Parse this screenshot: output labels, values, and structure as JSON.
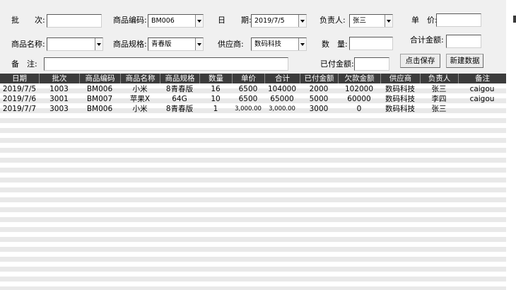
{
  "form": {
    "batch_label": "批　　次:",
    "batch_value": "",
    "code_label": "商品编码:",
    "code_value": "BM006",
    "date_label": "日　　期:",
    "date_value": "2019/7/5",
    "owner_label": "负责人:",
    "owner_value": "张三",
    "price_label": "单　价:",
    "price_value": "",
    "name_label": "商品名称:",
    "name_value": "",
    "spec_label": "商品规格:",
    "spec_value": "青春版",
    "supplier_label": "供应商:",
    "supplier_value": "数码科技",
    "qty_label": "数　量:",
    "qty_value": "",
    "total_label": "合计金额:",
    "total_value": "",
    "note_label": "备　注:",
    "note_value": "",
    "paid_label": "已付金额:",
    "paid_value": "",
    "save_button": "点击保存",
    "new_button": "新建数据"
  },
  "table": {
    "columns": [
      "日期",
      "批次",
      "商品编码",
      "商品名称",
      "商品规格",
      "数量",
      "单价",
      "合计",
      "已付金额",
      "欠款金额",
      "供应商",
      "负责人",
      "备注"
    ],
    "rows": [
      [
        "2019/7/5",
        "1003",
        "BM006",
        "小米",
        "8青春版",
        "16",
        "6500",
        "104000",
        "2000",
        "102000",
        "数码科技",
        "张三",
        "caigou"
      ],
      [
        "2019/7/6",
        "3001",
        "BM007",
        "苹果X",
        "64G",
        "10",
        "6500",
        "65000",
        "5000",
        "60000",
        "数码科技",
        "李四",
        "caigou"
      ],
      [
        "2019/7/7",
        "3003",
        "BM006",
        "小米",
        "8青春版",
        "1",
        "3,000.00",
        "3,000.00",
        "3000",
        "0",
        "数码科技",
        "张三",
        ""
      ]
    ]
  }
}
